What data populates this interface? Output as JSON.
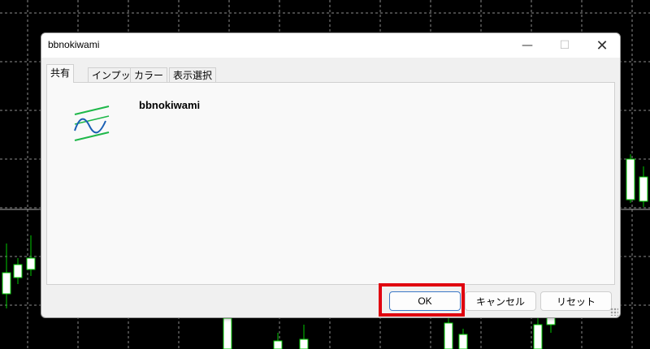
{
  "window": {
    "title": "bbnokiwami",
    "minimize_glyph": "—",
    "maximize_glyph": "☐",
    "close_glyph": "✕"
  },
  "tabs": [
    {
      "label": "共有",
      "active": true
    },
    {
      "label": "インプット",
      "active": false
    },
    {
      "label": "カラー",
      "active": false
    },
    {
      "label": "表示選択",
      "active": false
    }
  ],
  "panel": {
    "indicator_name": "bbnokiwami",
    "icon": "bollinger-bands-icon"
  },
  "buttons": {
    "ok": "OK",
    "cancel": "キャンセル",
    "reset": "リセット"
  },
  "colors": {
    "chart_background": "#000000",
    "grid": "#ffffff",
    "candle_up": "#00c800",
    "candle_body": "#ffffff",
    "icon_bands": "#1fb84a",
    "icon_wave": "#1a5fb4",
    "highlight": "#e0000f"
  }
}
